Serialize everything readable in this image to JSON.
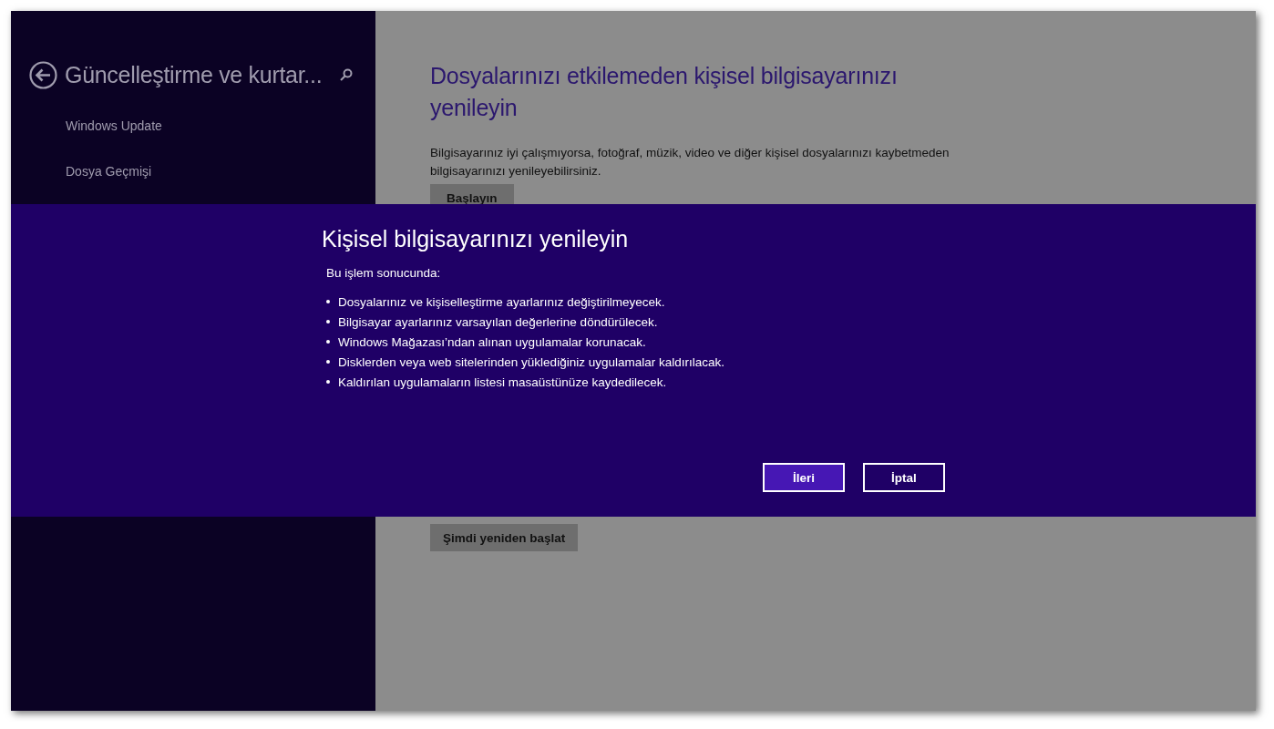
{
  "sidebar": {
    "title": "Güncelleştirme ve kurtar...",
    "items": [
      {
        "label": "Windows Update"
      },
      {
        "label": "Dosya Geçmişi"
      }
    ]
  },
  "content": {
    "heading": "Dosyalarınızı etkilemeden kişisel bilgisayarınızı yenileyin",
    "description": "Bilgisayarınız iyi çalışmıyorsa, fotoğraf, müzik, video ve diğer kişisel dosyalarınızı kaybetmeden bilgisayarınızı yenileyebilirsiniz.",
    "start_button": "Başlayın",
    "restart_button": "Şimdi yeniden başlat"
  },
  "dialog": {
    "title": "Kişisel bilgisayarınızı yenileyin",
    "intro": "Bu işlem sonucunda:",
    "bullets": [
      "Dosyalarınız ve kişiselleştirme ayarlarınız değiştirilmeyecek.",
      "Bilgisayar ayarlarınız varsayılan değerlerine döndürülecek.",
      "Windows Mağazası’ndan alınan uygulamalar korunacak.",
      "Disklerden veya web sitelerinden yüklediğiniz uygulamalar kaldırılacak.",
      "Kaldırılan uygulamaların listesi masaüstünüze kaydedilecek."
    ],
    "buttons": [
      {
        "label": "İleri",
        "kind": "primary"
      },
      {
        "label": "İptal",
        "kind": "secondary"
      }
    ]
  }
}
